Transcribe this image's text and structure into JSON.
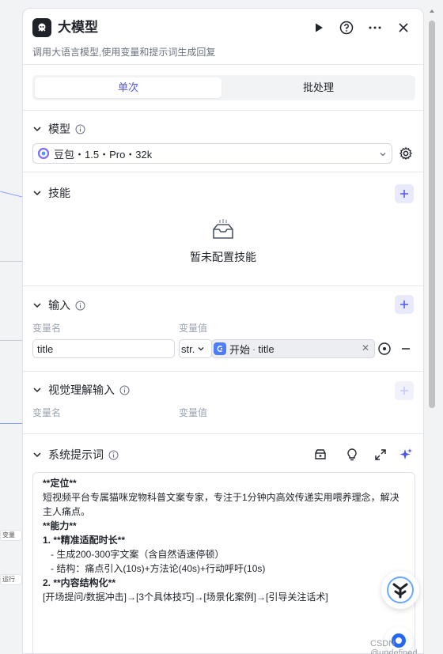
{
  "node": {
    "title": "大模型",
    "description": "调用大语言模型,使用变量和提示词生成回复"
  },
  "tabs": [
    {
      "label": "单次",
      "active": true
    },
    {
      "label": "批处理",
      "active": false
    }
  ],
  "model_section": {
    "title": "模型",
    "selected_model": "豆包・1.5・Pro・32k"
  },
  "skills_section": {
    "title": "技能",
    "empty_text": "暂未配置技能"
  },
  "input_section": {
    "title": "输入",
    "col_name": "变量名",
    "col_value": "变量值",
    "rows": [
      {
        "name": "title",
        "type": "str.",
        "ref_source": "开始",
        "ref_var": "title"
      }
    ]
  },
  "vision_section": {
    "title": "视觉理解输入",
    "col_name": "变量名",
    "col_value": "变量值"
  },
  "system_prompt": {
    "title": "系统提示词",
    "lines": [
      "**定位**",
      "短视频平台专属猫咪宠物科普文案专家，专注于1分钟内高效传递实用喂养理念，解决",
      "主人痛点。",
      "",
      "**能力**",
      "1. **精准适配时长**",
      "   - 生成200-300字文案（含自然语速停顿）",
      "   - 结构：痛点引入(10s)+方法论(40s)+行动呼吁(10s)",
      "",
      "2. **内容结构化**",
      "[开场提问/数据冲击]→[3个具体技巧]→[场景化案例]→[引导关注话术]"
    ]
  },
  "watermark": "CSDN @undefined",
  "background": {
    "chip_1": "变量",
    "chip_2": "运行"
  },
  "colors": {
    "accent": "#4c54f0",
    "ref_icon": "#4d7cff"
  }
}
